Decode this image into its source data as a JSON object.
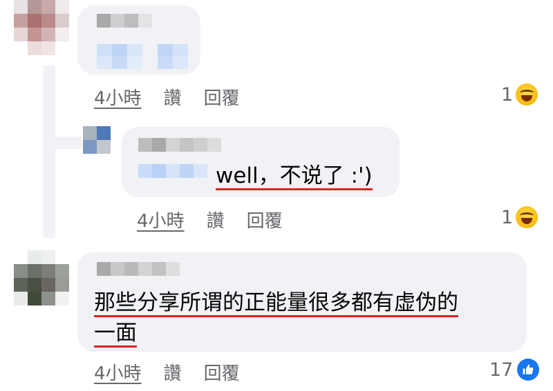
{
  "comments": [
    {
      "time": "4小時",
      "like": "讚",
      "reply": "回覆",
      "reaction_count": "1",
      "reaction_icon": "laugh-emoji-icon"
    },
    {
      "text": "well，不说了 :')",
      "time": "4小時",
      "like": "讚",
      "reply": "回覆",
      "reaction_count": "1",
      "reaction_icon": "laugh-emoji-icon"
    },
    {
      "text_line1": "那些分享所谓的正能量很多都有虚伪的",
      "text_line2": "一面",
      "time": "4小時",
      "like": "讚",
      "reply": "回覆",
      "reaction_count": "17",
      "reaction_icon": "like-icon"
    }
  ],
  "colors": {
    "bubble": "#f0f2f5",
    "meta_text": "#65676b",
    "underline_red": "#e41e1e",
    "like_blue": "#1877f2"
  }
}
